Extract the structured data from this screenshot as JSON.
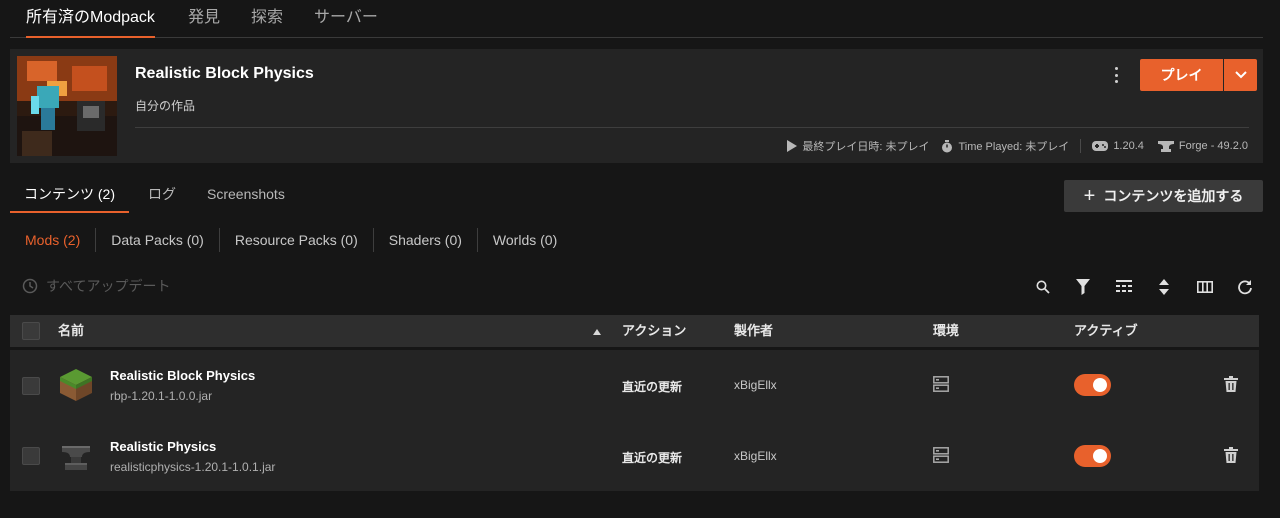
{
  "top_tabs": [
    {
      "label": "所有済のModpack"
    },
    {
      "label": "発見"
    },
    {
      "label": "探索"
    },
    {
      "label": "サーバー"
    }
  ],
  "modpack": {
    "title": "Realistic Block Physics",
    "subtitle": "自分の作品",
    "last_played": "最終プレイ日時: 未プレイ",
    "time_played": "Time Played: 未プレイ",
    "mc_version": "1.20.4",
    "loader": "Forge - 49.2.0",
    "play_label": "プレイ"
  },
  "content_tabs": [
    {
      "label": "コンテンツ (2)"
    },
    {
      "label": "ログ"
    },
    {
      "label": "Screenshots"
    }
  ],
  "add_button_label": "コンテンツを追加する",
  "filters": [
    {
      "label": "Mods (2)"
    },
    {
      "label": "Data Packs (0)"
    },
    {
      "label": "Resource Packs (0)"
    },
    {
      "label": "Shaders (0)"
    },
    {
      "label": "Worlds (0)"
    }
  ],
  "update_all_label": "すべてアップデート",
  "table": {
    "headers": {
      "name": "名前",
      "action": "アクション",
      "author": "製作者",
      "environment": "環境",
      "active": "アクティブ"
    },
    "rows": [
      {
        "name": "Realistic Block Physics",
        "file": "rbp-1.20.1-1.0.0.jar",
        "action": "直近の更新",
        "author": "xBigEllx",
        "active": true
      },
      {
        "name": "Realistic Physics",
        "file": "realisticphysics-1.20.1-1.0.1.jar",
        "action": "直近の更新",
        "author": "xBigEllx",
        "active": true
      }
    ]
  },
  "colors": {
    "accent": "#e8612c",
    "background": "#161616",
    "panel": "#242424"
  }
}
